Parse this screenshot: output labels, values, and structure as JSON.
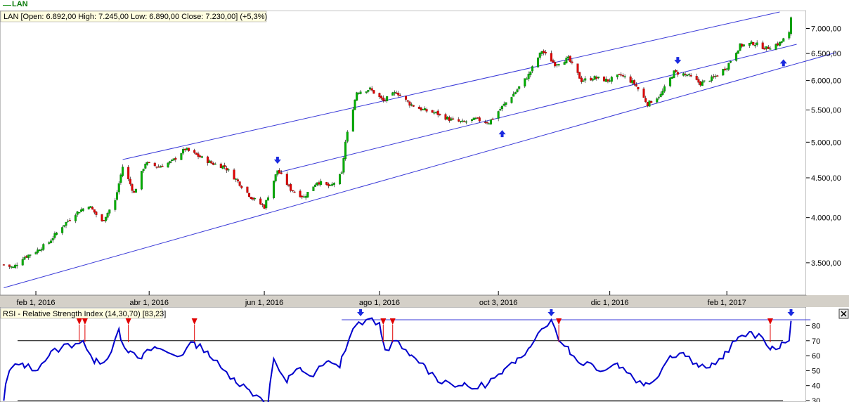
{
  "legend": {
    "symbol": "LAN"
  },
  "price_panel": {
    "title": "LAN [Open: 6.892,00  High: 7.245,00  Low: 6.890,00  Close: 7.230,00] (+5,3%)"
  },
  "rsi_panel": {
    "title": "RSI - Relative Strength Index (14,30,70) [83,23]",
    "close_icon": "close-icon"
  },
  "colors": {
    "up": "#00b000",
    "down": "#e00000",
    "channel": "#3a3ad8",
    "rsi": "#0000cc",
    "arrow": "#1a2adf",
    "signal": "#e00000"
  },
  "chart_data": [
    {
      "type": "candlestick",
      "title": "LAN",
      "y_scale": "log",
      "ylim": [
        3200,
        7350
      ],
      "y_ticks": [
        3500,
        4000,
        4500,
        5000,
        5500,
        6000,
        6500,
        7000
      ],
      "y_tick_labels": [
        "3.500,00",
        "4.000,00",
        "4.500,00",
        "5.000,00",
        "5.500,00",
        "6.000,00",
        "6.500,00",
        "7.000,00"
      ],
      "x_ticks": [
        {
          "date": "2016-02-01",
          "label": "feb 1, 2016"
        },
        {
          "date": "2016-04-01",
          "label": "abr 1, 2016"
        },
        {
          "date": "2016-06-01",
          "label": "jun 1, 2016"
        },
        {
          "date": "2016-08-01",
          "label": "ago 1, 2016"
        },
        {
          "date": "2016-10-03",
          "label": "oct 3, 2016"
        },
        {
          "date": "2016-12-01",
          "label": "dic 1, 2016"
        },
        {
          "date": "2017-02-01",
          "label": "feb 1, 2017"
        }
      ],
      "xlim": [
        "2016-01-13",
        "2017-03-15"
      ],
      "last_bar": {
        "open": 6892,
        "high": 7245,
        "low": 6890,
        "close": 7230,
        "change": "+5,3%"
      },
      "close_series": [
        [
          "2016-01-15",
          3480
        ],
        [
          "2016-01-20",
          3450
        ],
        [
          "2016-01-25",
          3550
        ],
        [
          "2016-02-01",
          3620
        ],
        [
          "2016-02-08",
          3720
        ],
        [
          "2016-02-15",
          3900
        ],
        [
          "2016-02-22",
          4050
        ],
        [
          "2016-02-29",
          4150
        ],
        [
          "2016-03-07",
          3950
        ],
        [
          "2016-03-14",
          4200
        ],
        [
          "2016-03-18",
          4650
        ],
        [
          "2016-03-24",
          4300
        ],
        [
          "2016-03-30",
          4700
        ],
        [
          "2016-04-06",
          4650
        ],
        [
          "2016-04-13",
          4720
        ],
        [
          "2016-04-20",
          4900
        ],
        [
          "2016-04-27",
          4800
        ],
        [
          "2016-05-04",
          4700
        ],
        [
          "2016-05-11",
          4650
        ],
        [
          "2016-05-18",
          4450
        ],
        [
          "2016-05-25",
          4250
        ],
        [
          "2016-06-01",
          4130
        ],
        [
          "2016-06-08",
          4600
        ],
        [
          "2016-06-15",
          4350
        ],
        [
          "2016-06-22",
          4250
        ],
        [
          "2016-06-29",
          4450
        ],
        [
          "2016-07-06",
          4380
        ],
        [
          "2016-07-12",
          4550
        ],
        [
          "2016-07-14",
          5000
        ],
        [
          "2016-07-20",
          5800
        ],
        [
          "2016-07-27",
          5850
        ],
        [
          "2016-08-03",
          5650
        ],
        [
          "2016-08-10",
          5800
        ],
        [
          "2016-08-17",
          5600
        ],
        [
          "2016-08-24",
          5500
        ],
        [
          "2016-08-31",
          5450
        ],
        [
          "2016-09-07",
          5350
        ],
        [
          "2016-09-14",
          5300
        ],
        [
          "2016-09-21",
          5350
        ],
        [
          "2016-09-28",
          5300
        ],
        [
          "2016-10-05",
          5550
        ],
        [
          "2016-10-12",
          5800
        ],
        [
          "2016-10-19",
          6100
        ],
        [
          "2016-10-26",
          6550
        ],
        [
          "2016-11-02",
          6300
        ],
        [
          "2016-11-09",
          6400
        ],
        [
          "2016-11-16",
          6000
        ],
        [
          "2016-11-23",
          6050
        ],
        [
          "2016-11-30",
          6000
        ],
        [
          "2016-12-07",
          6100
        ],
        [
          "2016-12-14",
          5950
        ],
        [
          "2016-12-21",
          5600
        ],
        [
          "2016-12-28",
          5750
        ],
        [
          "2017-01-04",
          6150
        ],
        [
          "2017-01-11",
          6100
        ],
        [
          "2017-01-18",
          5950
        ],
        [
          "2017-01-25",
          6050
        ],
        [
          "2017-02-01",
          6250
        ],
        [
          "2017-02-08",
          6650
        ],
        [
          "2017-02-15",
          6700
        ],
        [
          "2017-02-22",
          6600
        ],
        [
          "2017-03-01",
          6700
        ],
        [
          "2017-03-06",
          6892
        ],
        [
          "2017-03-07",
          7230
        ]
      ],
      "channel_lines": [
        {
          "name": "upper",
          "from": [
            "2016-03-18",
            4750
          ],
          "to": [
            "2017-03-01",
            7350
          ]
        },
        {
          "name": "middle",
          "from": [
            "2016-06-08",
            4570
          ],
          "to": [
            "2017-03-10",
            6680
          ]
        },
        {
          "name": "lower",
          "from": [
            "2016-01-15",
            3250
          ],
          "to": [
            "2017-03-31",
            6520
          ]
        }
      ],
      "arrows": [
        {
          "date": "2016-06-08",
          "value": 4720,
          "direction": "down"
        },
        {
          "date": "2016-10-05",
          "value": 5150,
          "direction": "up"
        },
        {
          "date": "2017-01-06",
          "value": 6340,
          "direction": "down"
        },
        {
          "date": "2017-03-03",
          "value": 6350,
          "direction": "up"
        }
      ]
    },
    {
      "type": "line",
      "title": "RSI - Relative Strength Index (14,30,70) [83,23]",
      "ylim": [
        30,
        90
      ],
      "y_ticks": [
        30,
        40,
        50,
        60,
        70,
        80
      ],
      "y_tick_labels": [
        "30",
        "40",
        "50",
        "60",
        "70",
        "80"
      ],
      "levels": [
        30,
        70
      ],
      "series": [
        {
          "values": [
            [
              "2016-01-15",
              30
            ],
            [
              "2016-01-18",
              50
            ],
            [
              "2016-01-25",
              55
            ],
            [
              "2016-02-01",
              50
            ],
            [
              "2016-02-08",
              60
            ],
            [
              "2016-02-15",
              66
            ],
            [
              "2016-02-22",
              68
            ],
            [
              "2016-02-26",
              70
            ],
            [
              "2016-03-03",
              55
            ],
            [
              "2016-03-10",
              58
            ],
            [
              "2016-03-16",
              78
            ],
            [
              "2016-03-21",
              62
            ],
            [
              "2016-03-28",
              58
            ],
            [
              "2016-04-04",
              66
            ],
            [
              "2016-04-11",
              62
            ],
            [
              "2016-04-18",
              60
            ],
            [
              "2016-04-25",
              69
            ],
            [
              "2016-05-02",
              63
            ],
            [
              "2016-05-09",
              52
            ],
            [
              "2016-05-16",
              45
            ],
            [
              "2016-05-23",
              38
            ],
            [
              "2016-05-30",
              32
            ],
            [
              "2016-06-03",
              28
            ],
            [
              "2016-06-06",
              58
            ],
            [
              "2016-06-13",
              42
            ],
            [
              "2016-06-20",
              52
            ],
            [
              "2016-06-27",
              46
            ],
            [
              "2016-07-04",
              56
            ],
            [
              "2016-07-11",
              52
            ],
            [
              "2016-07-18",
              78
            ],
            [
              "2016-07-25",
              84
            ],
            [
              "2016-08-01",
              82
            ],
            [
              "2016-08-04",
              64
            ],
            [
              "2016-08-10",
              70
            ],
            [
              "2016-08-17",
              60
            ],
            [
              "2016-08-24",
              55
            ],
            [
              "2016-08-31",
              45
            ],
            [
              "2016-09-07",
              42
            ],
            [
              "2016-09-14",
              40
            ],
            [
              "2016-09-21",
              38
            ],
            [
              "2016-09-28",
              42
            ],
            [
              "2016-10-05",
              48
            ],
            [
              "2016-10-12",
              55
            ],
            [
              "2016-10-19",
              65
            ],
            [
              "2016-10-26",
              78
            ],
            [
              "2016-10-31",
              84
            ],
            [
              "2016-11-04",
              70
            ],
            [
              "2016-11-09",
              66
            ],
            [
              "2016-11-14",
              56
            ],
            [
              "2016-11-21",
              55
            ],
            [
              "2016-11-28",
              50
            ],
            [
              "2016-12-05",
              55
            ],
            [
              "2016-12-12",
              48
            ],
            [
              "2016-12-19",
              40
            ],
            [
              "2016-12-26",
              45
            ],
            [
              "2017-01-02",
              60
            ],
            [
              "2017-01-09",
              62
            ],
            [
              "2017-01-16",
              55
            ],
            [
              "2017-01-23",
              52
            ],
            [
              "2017-01-30",
              58
            ],
            [
              "2017-02-06",
              70
            ],
            [
              "2017-02-13",
              76
            ],
            [
              "2017-02-20",
              72
            ],
            [
              "2017-02-24",
              64
            ],
            [
              "2017-03-01",
              65
            ],
            [
              "2017-03-06",
              70
            ],
            [
              "2017-03-07",
              83.23
            ]
          ]
        }
      ],
      "markers": [
        {
          "date": "2016-02-24",
          "type": "signal"
        },
        {
          "date": "2016-02-27",
          "type": "signal"
        },
        {
          "date": "2016-03-21",
          "type": "signal"
        },
        {
          "date": "2016-04-25",
          "type": "signal"
        },
        {
          "date": "2016-07-22",
          "type": "arrow"
        },
        {
          "date": "2016-08-03",
          "type": "signal"
        },
        {
          "date": "2016-08-08",
          "type": "signal"
        },
        {
          "date": "2016-10-31",
          "type": "arrow"
        },
        {
          "date": "2016-11-04",
          "type": "signal"
        },
        {
          "date": "2017-02-24",
          "type": "signal"
        },
        {
          "date": "2017-03-07",
          "type": "arrow"
        }
      ],
      "signal_line": {
        "from": "2016-07-12",
        "to": "2017-03-08",
        "value": 84
      }
    }
  ]
}
